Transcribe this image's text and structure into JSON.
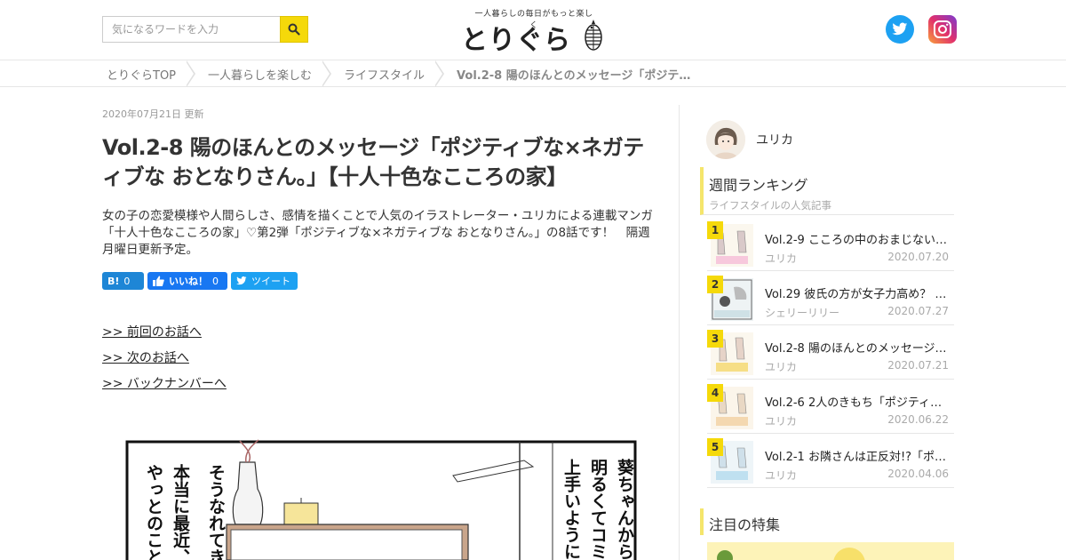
{
  "header": {
    "search_placeholder": "気になるワードを入力",
    "logo_tagline": "一人暮らしの毎日がもっと楽しく",
    "logo_text": "とりぐら",
    "social": [
      "twitter-icon",
      "instagram-icon"
    ]
  },
  "breadcrumb": [
    "とりぐらTOP",
    "一人暮らしを楽しむ",
    "ライフスタイル",
    "Vol.2-8 陽のほんとのメッセージ「ポジテ…"
  ],
  "article": {
    "date": "2020年07月21日 更新",
    "title": "Vol.2-8 陽のほんとのメッセージ「ポジティブな×ネガティブな おとなりさん。」【十人十色なこころの家】",
    "lead": "女の子の恋愛模様や人間らしさ、感情を描くことで人気のイラストレーター・ユリカによる連載マンガ「十人十色なこころの家」♡第2弾「ポジティブな×ネガティブな おとなりさん。」の8話です！　隔週月曜日更新予定。",
    "share": {
      "hatena_label": "B!",
      "hatena_count": "0",
      "fb_label": "いいね！",
      "fb_count": "0",
      "tweet_label": "ツイート"
    },
    "links": [
      ">> 前回のお話へ",
      ">> 次のお話へ",
      ">> バックナンバーへ"
    ],
    "manga_text_left": [
      "やっとのこと",
      "本当に最近、",
      "そうなれてき"
    ],
    "manga_text_right": [
      "葵ちゃんからし",
      "明るくてコミュ",
      "上手いように見"
    ]
  },
  "sidebar": {
    "author_name": "ユリカ",
    "ranking_title": "週間ランキング",
    "ranking_subtitle": "ライフスタイルの人気記事",
    "ranking": [
      {
        "rank": "1",
        "title": "Vol.2-9 こころの中のおまじない…",
        "author": "ユリカ",
        "date": "2020.07.20"
      },
      {
        "rank": "2",
        "title": "Vol.29 彼氏の方が女子力高め？ …",
        "author": "シェリーリリー",
        "date": "2020.07.27"
      },
      {
        "rank": "3",
        "title": "Vol.2-8 陽のほんとのメッセージ…",
        "author": "ユリカ",
        "date": "2020.07.21"
      },
      {
        "rank": "4",
        "title": "Vol.2-6 2人のきもち「ポジティブ…",
        "author": "ユリカ",
        "date": "2020.06.22"
      },
      {
        "rank": "5",
        "title": "Vol.2-1 お隣さんは正反対!?「ポ…",
        "author": "ユリカ",
        "date": "2020.04.06"
      }
    ],
    "feature_title": "注目の特集"
  },
  "colors": {
    "accent_yellow": "#f5d90a",
    "twitter": "#1da1f2",
    "facebook": "#1877f2",
    "hatena": "#1e86d6"
  }
}
